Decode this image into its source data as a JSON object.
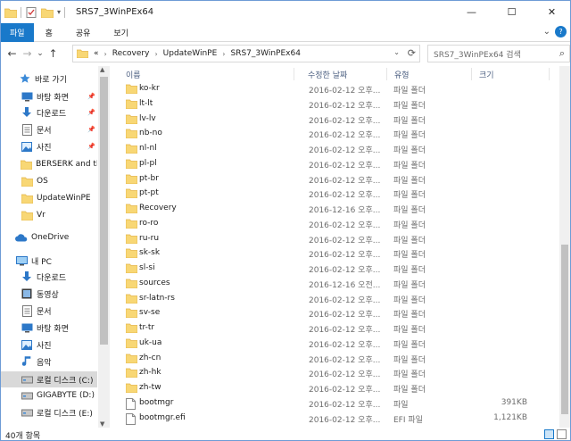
{
  "window": {
    "title": "SRS7_3WinPEx64",
    "buttons": {
      "minimize": "—",
      "maximize": "☐",
      "close": "✕"
    }
  },
  "ribbon": {
    "tabs": [
      "파일",
      "홈",
      "공유",
      "보기"
    ],
    "expand_glyph": "⌄",
    "help_glyph": "?"
  },
  "nav": {
    "back": "←",
    "forward": "→",
    "recent": "⌄",
    "up": "↑",
    "breadcrumb": [
      "«",
      "Recovery",
      "UpdateWinPE",
      "SRS7_3WinPEx64"
    ],
    "dropdown": "⌄",
    "refresh": "⟳"
  },
  "search": {
    "placeholder": "SRS7_3WinPEx64 검색"
  },
  "navpane": {
    "items": [
      {
        "label": "바로 가기",
        "icon": "star-icon",
        "pinned": false
      },
      {
        "label": "바탕 화면",
        "icon": "desktop-icon",
        "pinned": true
      },
      {
        "label": "다운로드",
        "icon": "download-icon",
        "pinned": true
      },
      {
        "label": "문서",
        "icon": "documents-icon",
        "pinned": true
      },
      {
        "label": "사진",
        "icon": "pictures-icon",
        "pinned": true
      },
      {
        "label": "BERSERK and th",
        "icon": "folder-icon",
        "pinned": false
      },
      {
        "label": "OS",
        "icon": "folder-icon",
        "pinned": false
      },
      {
        "label": "UpdateWinPE",
        "icon": "folder-icon",
        "pinned": false
      },
      {
        "label": "Vr",
        "icon": "folder-icon",
        "pinned": false
      },
      {
        "label": "OneDrive",
        "icon": "onedrive-icon",
        "pinned": false
      },
      {
        "label": "내 PC",
        "icon": "pc-icon",
        "pinned": false
      },
      {
        "label": "다운로드",
        "icon": "download-icon",
        "pinned": false
      },
      {
        "label": "동영상",
        "icon": "videos-icon",
        "pinned": false
      },
      {
        "label": "문서",
        "icon": "documents-icon",
        "pinned": false
      },
      {
        "label": "바탕 화면",
        "icon": "desktop-icon",
        "pinned": false
      },
      {
        "label": "사진",
        "icon": "pictures-icon",
        "pinned": false
      },
      {
        "label": "음악",
        "icon": "music-icon",
        "pinned": false
      },
      {
        "label": "로컬 디스크 (C:)",
        "icon": "drive-icon",
        "pinned": false,
        "selected": true
      },
      {
        "label": "GIGABYTE (D:)",
        "icon": "drive-icon",
        "pinned": false
      },
      {
        "label": "로컬 디스크 (E:)",
        "icon": "drive-icon",
        "pinned": false
      }
    ]
  },
  "columns": {
    "name": "이름",
    "date": "수정한 날짜",
    "type": "유형",
    "size": "크기"
  },
  "files": [
    {
      "name": "ko-kr",
      "date": "2016-02-12 오후...",
      "type": "파일 폴더",
      "size": "",
      "kind": "folder"
    },
    {
      "name": "lt-lt",
      "date": "2016-02-12 오후...",
      "type": "파일 폴더",
      "size": "",
      "kind": "folder"
    },
    {
      "name": "lv-lv",
      "date": "2016-02-12 오후...",
      "type": "파일 폴더",
      "size": "",
      "kind": "folder"
    },
    {
      "name": "nb-no",
      "date": "2016-02-12 오후...",
      "type": "파일 폴더",
      "size": "",
      "kind": "folder"
    },
    {
      "name": "nl-nl",
      "date": "2016-02-12 오후...",
      "type": "파일 폴더",
      "size": "",
      "kind": "folder"
    },
    {
      "name": "pl-pl",
      "date": "2016-02-12 오후...",
      "type": "파일 폴더",
      "size": "",
      "kind": "folder"
    },
    {
      "name": "pt-br",
      "date": "2016-02-12 오후...",
      "type": "파일 폴더",
      "size": "",
      "kind": "folder"
    },
    {
      "name": "pt-pt",
      "date": "2016-02-12 오후...",
      "type": "파일 폴더",
      "size": "",
      "kind": "folder"
    },
    {
      "name": "Recovery",
      "date": "2016-12-16 오후...",
      "type": "파일 폴더",
      "size": "",
      "kind": "folder"
    },
    {
      "name": "ro-ro",
      "date": "2016-02-12 오후...",
      "type": "파일 폴더",
      "size": "",
      "kind": "folder"
    },
    {
      "name": "ru-ru",
      "date": "2016-02-12 오후...",
      "type": "파일 폴더",
      "size": "",
      "kind": "folder"
    },
    {
      "name": "sk-sk",
      "date": "2016-02-12 오후...",
      "type": "파일 폴더",
      "size": "",
      "kind": "folder"
    },
    {
      "name": "sl-si",
      "date": "2016-02-12 오후...",
      "type": "파일 폴더",
      "size": "",
      "kind": "folder"
    },
    {
      "name": "sources",
      "date": "2016-12-16 오전...",
      "type": "파일 폴더",
      "size": "",
      "kind": "folder"
    },
    {
      "name": "sr-latn-rs",
      "date": "2016-02-12 오후...",
      "type": "파일 폴더",
      "size": "",
      "kind": "folder"
    },
    {
      "name": "sv-se",
      "date": "2016-02-12 오후...",
      "type": "파일 폴더",
      "size": "",
      "kind": "folder"
    },
    {
      "name": "tr-tr",
      "date": "2016-02-12 오후...",
      "type": "파일 폴더",
      "size": "",
      "kind": "folder"
    },
    {
      "name": "uk-ua",
      "date": "2016-02-12 오후...",
      "type": "파일 폴더",
      "size": "",
      "kind": "folder"
    },
    {
      "name": "zh-cn",
      "date": "2016-02-12 오후...",
      "type": "파일 폴더",
      "size": "",
      "kind": "folder"
    },
    {
      "name": "zh-hk",
      "date": "2016-02-12 오후...",
      "type": "파일 폴더",
      "size": "",
      "kind": "folder"
    },
    {
      "name": "zh-tw",
      "date": "2016-02-12 오후...",
      "type": "파일 폴더",
      "size": "",
      "kind": "folder"
    },
    {
      "name": "bootmgr",
      "date": "2016-02-12 오후...",
      "type": "파일",
      "size": "391KB",
      "kind": "file"
    },
    {
      "name": "bootmgr.efi",
      "date": "2016-02-12 오후...",
      "type": "EFI 파일",
      "size": "1,121KB",
      "kind": "file"
    }
  ],
  "status": {
    "item_count": "40개 항목"
  },
  "colors": {
    "accent": "#1979ca",
    "folder": "#f8d775",
    "folder_dark": "#e3b446",
    "selected": "#d9d9d9"
  }
}
